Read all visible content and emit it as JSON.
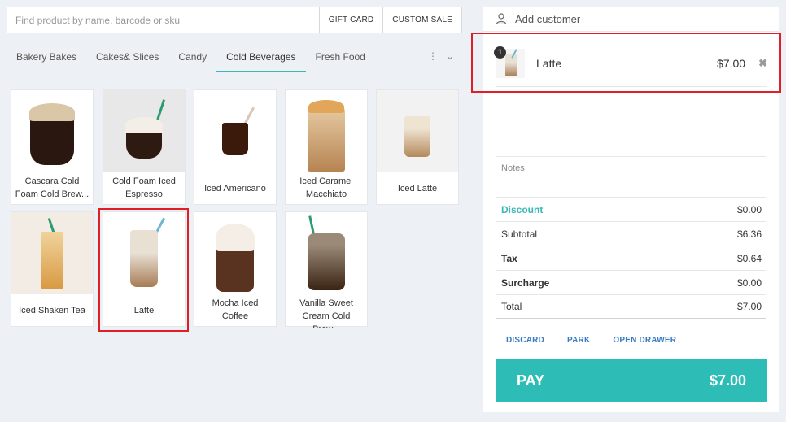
{
  "search": {
    "placeholder": "Find product by name, barcode or sku"
  },
  "header_buttons": {
    "gift_card": "GIFT CARD",
    "custom_sale": "CUSTOM SALE"
  },
  "tabs": [
    {
      "label": "Bakery Bakes",
      "active": false
    },
    {
      "label": "Cakes& Slices",
      "active": false
    },
    {
      "label": "Candy",
      "active": false
    },
    {
      "label": "Cold Beverages",
      "active": true
    },
    {
      "label": "Fresh Food",
      "active": false
    }
  ],
  "tab_more": {
    "icon": "vertical-ellipsis-icon",
    "chevron": "chevron-down-icon"
  },
  "products": [
    {
      "name": "Cascara Cold Foam Cold Brew",
      "display": "Cascara Cold\nFoam Cold Brew..."
    },
    {
      "name": "Cold Foam Iced Espresso",
      "display": "Cold Foam Iced\nEspresso"
    },
    {
      "name": "Iced Americano",
      "display": "Iced Americano"
    },
    {
      "name": "Iced Caramel Macchiato",
      "display": "Iced Caramel\nMacchiato"
    },
    {
      "name": "Iced Latte",
      "display": "Iced Latte"
    },
    {
      "name": "Iced Shaken Tea",
      "display": "Iced Shaken Tea"
    },
    {
      "name": "Latte",
      "display": "Latte"
    },
    {
      "name": "Mocha Iced Coffee",
      "display": "Mocha Iced\nCoffee"
    },
    {
      "name": "Vanilla Sweet Cream Cold Brew",
      "display": "Vanilla Sweet\nCream Cold Brew..."
    }
  ],
  "customer": {
    "label": "Add customer",
    "icon": "user-icon"
  },
  "cart": {
    "items": [
      {
        "qty": "1",
        "name": "Latte",
        "price": "$7.00"
      }
    ]
  },
  "notes": {
    "placeholder": "Notes"
  },
  "totals": {
    "discount": {
      "label": "Discount",
      "value": "$0.00"
    },
    "subtotal": {
      "label": "Subtotal",
      "value": "$6.36"
    },
    "tax": {
      "label": "Tax",
      "value": "$0.64"
    },
    "surcharge": {
      "label": "Surcharge",
      "value": "$0.00"
    },
    "total": {
      "label": "Total",
      "value": "$7.00"
    }
  },
  "actions": {
    "discard": "DISCARD",
    "park": "PARK",
    "open_drawer": "OPEN DRAWER"
  },
  "pay": {
    "label": "PAY",
    "amount": "$7.00"
  },
  "colors": {
    "accent": "#2dbcb6",
    "highlight": "#e01e25",
    "link": "#3a7abf"
  }
}
